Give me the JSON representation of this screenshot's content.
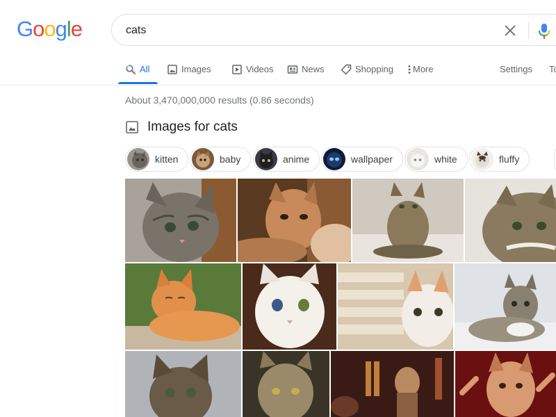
{
  "logo": {
    "letters": [
      {
        "char": "G",
        "color": "#4285F4"
      },
      {
        "char": "o",
        "color": "#EA4335"
      },
      {
        "char": "o",
        "color": "#FBBC05"
      },
      {
        "char": "g",
        "color": "#4285F4"
      },
      {
        "char": "l",
        "color": "#34A853"
      },
      {
        "char": "e",
        "color": "#EA4335"
      }
    ]
  },
  "search": {
    "value": "cats",
    "clear_icon": "close-icon",
    "mic_icon": "microphone-icon"
  },
  "tabs": [
    {
      "label": "All",
      "icon": "search-icon",
      "active": true
    },
    {
      "label": "Images",
      "icon": "image-icon",
      "active": false
    },
    {
      "label": "Videos",
      "icon": "play-icon",
      "active": false
    },
    {
      "label": "News",
      "icon": "newspaper-icon",
      "active": false
    },
    {
      "label": "Shopping",
      "icon": "tag-icon",
      "active": false
    },
    {
      "label": "More",
      "icon": "more-vertical-icon",
      "active": false
    },
    {
      "label": "Settings",
      "icon": "",
      "active": false
    },
    {
      "label": "Tools",
      "icon": "",
      "active": false
    }
  ],
  "stats": {
    "text": "About 3,470,000,000 results (0.86 seconds)"
  },
  "images_section": {
    "heading": "Images for cats",
    "icon": "image-icon"
  },
  "chips": [
    {
      "label": "kitten"
    },
    {
      "label": "baby"
    },
    {
      "label": "anime"
    },
    {
      "label": "wallpaper"
    },
    {
      "label": "white"
    },
    {
      "label": "fluffy"
    }
  ],
  "colors": {
    "accent": "#1a73e8",
    "muted_text": "#70757a",
    "border": "#dfe1e5"
  }
}
